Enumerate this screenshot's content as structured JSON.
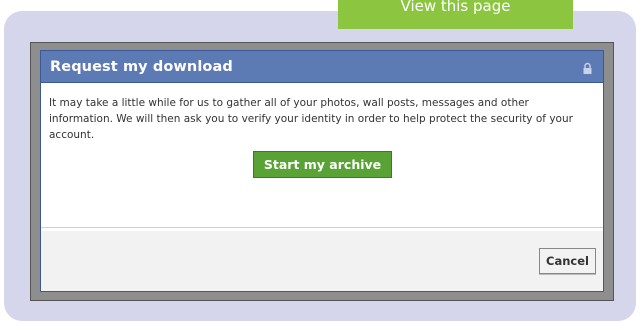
{
  "callout": {
    "text": "View this page"
  },
  "dialog": {
    "title": "Request my download",
    "body_text": "It may take a little while for us to gather all of your photos, wall posts, messages and other information. We will then ask you to verify your identity in order to help protect the security of your account.",
    "start_button_label": "Start my archive",
    "cancel_button_label": "Cancel"
  },
  "colors": {
    "frame": "#d5d5ec",
    "callout": "#8cc641",
    "header": "#5c7ab4",
    "start_button": "#59a336"
  },
  "icons": {
    "header_icon": "lock-icon"
  }
}
